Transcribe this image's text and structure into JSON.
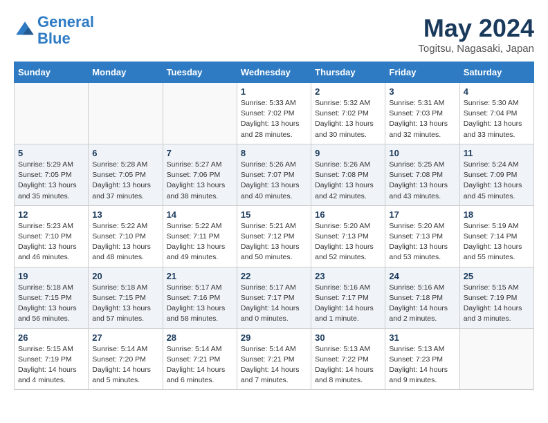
{
  "header": {
    "logo_line1": "General",
    "logo_line2": "Blue",
    "month_title": "May 2024",
    "location": "Togitsu, Nagasaki, Japan"
  },
  "days_of_week": [
    "Sunday",
    "Monday",
    "Tuesday",
    "Wednesday",
    "Thursday",
    "Friday",
    "Saturday"
  ],
  "weeks": [
    [
      {
        "day": "",
        "sunrise": "",
        "sunset": "",
        "daylight": ""
      },
      {
        "day": "",
        "sunrise": "",
        "sunset": "",
        "daylight": ""
      },
      {
        "day": "",
        "sunrise": "",
        "sunset": "",
        "daylight": ""
      },
      {
        "day": "1",
        "sunrise": "Sunrise: 5:33 AM",
        "sunset": "Sunset: 7:02 PM",
        "daylight": "Daylight: 13 hours and 28 minutes."
      },
      {
        "day": "2",
        "sunrise": "Sunrise: 5:32 AM",
        "sunset": "Sunset: 7:02 PM",
        "daylight": "Daylight: 13 hours and 30 minutes."
      },
      {
        "day": "3",
        "sunrise": "Sunrise: 5:31 AM",
        "sunset": "Sunset: 7:03 PM",
        "daylight": "Daylight: 13 hours and 32 minutes."
      },
      {
        "day": "4",
        "sunrise": "Sunrise: 5:30 AM",
        "sunset": "Sunset: 7:04 PM",
        "daylight": "Daylight: 13 hours and 33 minutes."
      }
    ],
    [
      {
        "day": "5",
        "sunrise": "Sunrise: 5:29 AM",
        "sunset": "Sunset: 7:05 PM",
        "daylight": "Daylight: 13 hours and 35 minutes."
      },
      {
        "day": "6",
        "sunrise": "Sunrise: 5:28 AM",
        "sunset": "Sunset: 7:05 PM",
        "daylight": "Daylight: 13 hours and 37 minutes."
      },
      {
        "day": "7",
        "sunrise": "Sunrise: 5:27 AM",
        "sunset": "Sunset: 7:06 PM",
        "daylight": "Daylight: 13 hours and 38 minutes."
      },
      {
        "day": "8",
        "sunrise": "Sunrise: 5:26 AM",
        "sunset": "Sunset: 7:07 PM",
        "daylight": "Daylight: 13 hours and 40 minutes."
      },
      {
        "day": "9",
        "sunrise": "Sunrise: 5:26 AM",
        "sunset": "Sunset: 7:08 PM",
        "daylight": "Daylight: 13 hours and 42 minutes."
      },
      {
        "day": "10",
        "sunrise": "Sunrise: 5:25 AM",
        "sunset": "Sunset: 7:08 PM",
        "daylight": "Daylight: 13 hours and 43 minutes."
      },
      {
        "day": "11",
        "sunrise": "Sunrise: 5:24 AM",
        "sunset": "Sunset: 7:09 PM",
        "daylight": "Daylight: 13 hours and 45 minutes."
      }
    ],
    [
      {
        "day": "12",
        "sunrise": "Sunrise: 5:23 AM",
        "sunset": "Sunset: 7:10 PM",
        "daylight": "Daylight: 13 hours and 46 minutes."
      },
      {
        "day": "13",
        "sunrise": "Sunrise: 5:22 AM",
        "sunset": "Sunset: 7:10 PM",
        "daylight": "Daylight: 13 hours and 48 minutes."
      },
      {
        "day": "14",
        "sunrise": "Sunrise: 5:22 AM",
        "sunset": "Sunset: 7:11 PM",
        "daylight": "Daylight: 13 hours and 49 minutes."
      },
      {
        "day": "15",
        "sunrise": "Sunrise: 5:21 AM",
        "sunset": "Sunset: 7:12 PM",
        "daylight": "Daylight: 13 hours and 50 minutes."
      },
      {
        "day": "16",
        "sunrise": "Sunrise: 5:20 AM",
        "sunset": "Sunset: 7:13 PM",
        "daylight": "Daylight: 13 hours and 52 minutes."
      },
      {
        "day": "17",
        "sunrise": "Sunrise: 5:20 AM",
        "sunset": "Sunset: 7:13 PM",
        "daylight": "Daylight: 13 hours and 53 minutes."
      },
      {
        "day": "18",
        "sunrise": "Sunrise: 5:19 AM",
        "sunset": "Sunset: 7:14 PM",
        "daylight": "Daylight: 13 hours and 55 minutes."
      }
    ],
    [
      {
        "day": "19",
        "sunrise": "Sunrise: 5:18 AM",
        "sunset": "Sunset: 7:15 PM",
        "daylight": "Daylight: 13 hours and 56 minutes."
      },
      {
        "day": "20",
        "sunrise": "Sunrise: 5:18 AM",
        "sunset": "Sunset: 7:15 PM",
        "daylight": "Daylight: 13 hours and 57 minutes."
      },
      {
        "day": "21",
        "sunrise": "Sunrise: 5:17 AM",
        "sunset": "Sunset: 7:16 PM",
        "daylight": "Daylight: 13 hours and 58 minutes."
      },
      {
        "day": "22",
        "sunrise": "Sunrise: 5:17 AM",
        "sunset": "Sunset: 7:17 PM",
        "daylight": "Daylight: 14 hours and 0 minutes."
      },
      {
        "day": "23",
        "sunrise": "Sunrise: 5:16 AM",
        "sunset": "Sunset: 7:17 PM",
        "daylight": "Daylight: 14 hours and 1 minute."
      },
      {
        "day": "24",
        "sunrise": "Sunrise: 5:16 AM",
        "sunset": "Sunset: 7:18 PM",
        "daylight": "Daylight: 14 hours and 2 minutes."
      },
      {
        "day": "25",
        "sunrise": "Sunrise: 5:15 AM",
        "sunset": "Sunset: 7:19 PM",
        "daylight": "Daylight: 14 hours and 3 minutes."
      }
    ],
    [
      {
        "day": "26",
        "sunrise": "Sunrise: 5:15 AM",
        "sunset": "Sunset: 7:19 PM",
        "daylight": "Daylight: 14 hours and 4 minutes."
      },
      {
        "day": "27",
        "sunrise": "Sunrise: 5:14 AM",
        "sunset": "Sunset: 7:20 PM",
        "daylight": "Daylight: 14 hours and 5 minutes."
      },
      {
        "day": "28",
        "sunrise": "Sunrise: 5:14 AM",
        "sunset": "Sunset: 7:21 PM",
        "daylight": "Daylight: 14 hours and 6 minutes."
      },
      {
        "day": "29",
        "sunrise": "Sunrise: 5:14 AM",
        "sunset": "Sunset: 7:21 PM",
        "daylight": "Daylight: 14 hours and 7 minutes."
      },
      {
        "day": "30",
        "sunrise": "Sunrise: 5:13 AM",
        "sunset": "Sunset: 7:22 PM",
        "daylight": "Daylight: 14 hours and 8 minutes."
      },
      {
        "day": "31",
        "sunrise": "Sunrise: 5:13 AM",
        "sunset": "Sunset: 7:23 PM",
        "daylight": "Daylight: 14 hours and 9 minutes."
      },
      {
        "day": "",
        "sunrise": "",
        "sunset": "",
        "daylight": ""
      }
    ]
  ]
}
